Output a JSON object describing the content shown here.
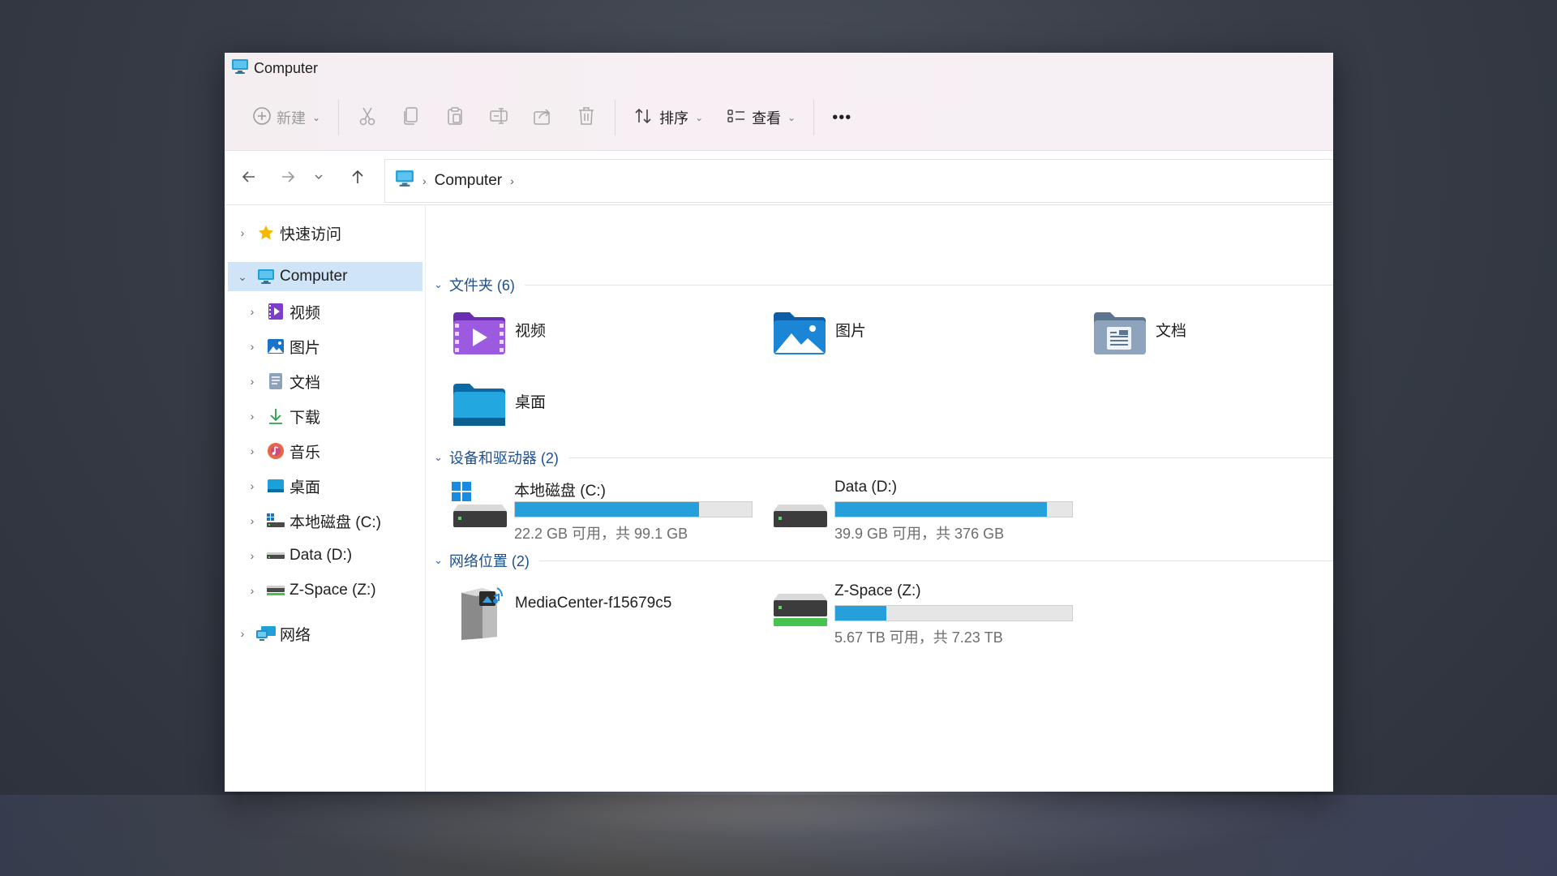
{
  "window": {
    "title": "Computer"
  },
  "toolbar": {
    "new_label": "新建",
    "sort_label": "排序",
    "view_label": "查看",
    "more_label": "•••"
  },
  "address": {
    "path": [
      "Computer"
    ]
  },
  "sidebar": {
    "quick_access": "快速访问",
    "computer": "Computer",
    "items": [
      "视频",
      "图片",
      "文档",
      "下载",
      "音乐",
      "桌面",
      "本地磁盘 (C:)",
      "Data (D:)",
      "Z-Space (Z:)"
    ],
    "network": "网络"
  },
  "groups": {
    "folders": {
      "title": "文件夹 (6)",
      "items": [
        "视频",
        "图片",
        "文档",
        "桌面"
      ]
    },
    "drives": {
      "title": "设备和驱动器 (2)"
    },
    "network": {
      "title": "网络位置 (2)"
    }
  },
  "drives": [
    {
      "name": "本地磁盘 (C:)",
      "free": "22.2 GB 可用，共 99.1 GB",
      "used_fraction": 0.776
    },
    {
      "name": "Data (D:)",
      "free": "39.9 GB 可用，共 376 GB",
      "used_fraction": 0.894
    }
  ],
  "network_items": [
    {
      "name": "MediaCenter-f15679c5"
    },
    {
      "name": "Z-Space (Z:)",
      "free": "5.67 TB 可用，共 7.23 TB",
      "used_fraction": 0.216
    }
  ],
  "colors": {
    "accent": "#26a0da",
    "selection": "#cfe4f6",
    "group_header": "#1d4f91"
  }
}
